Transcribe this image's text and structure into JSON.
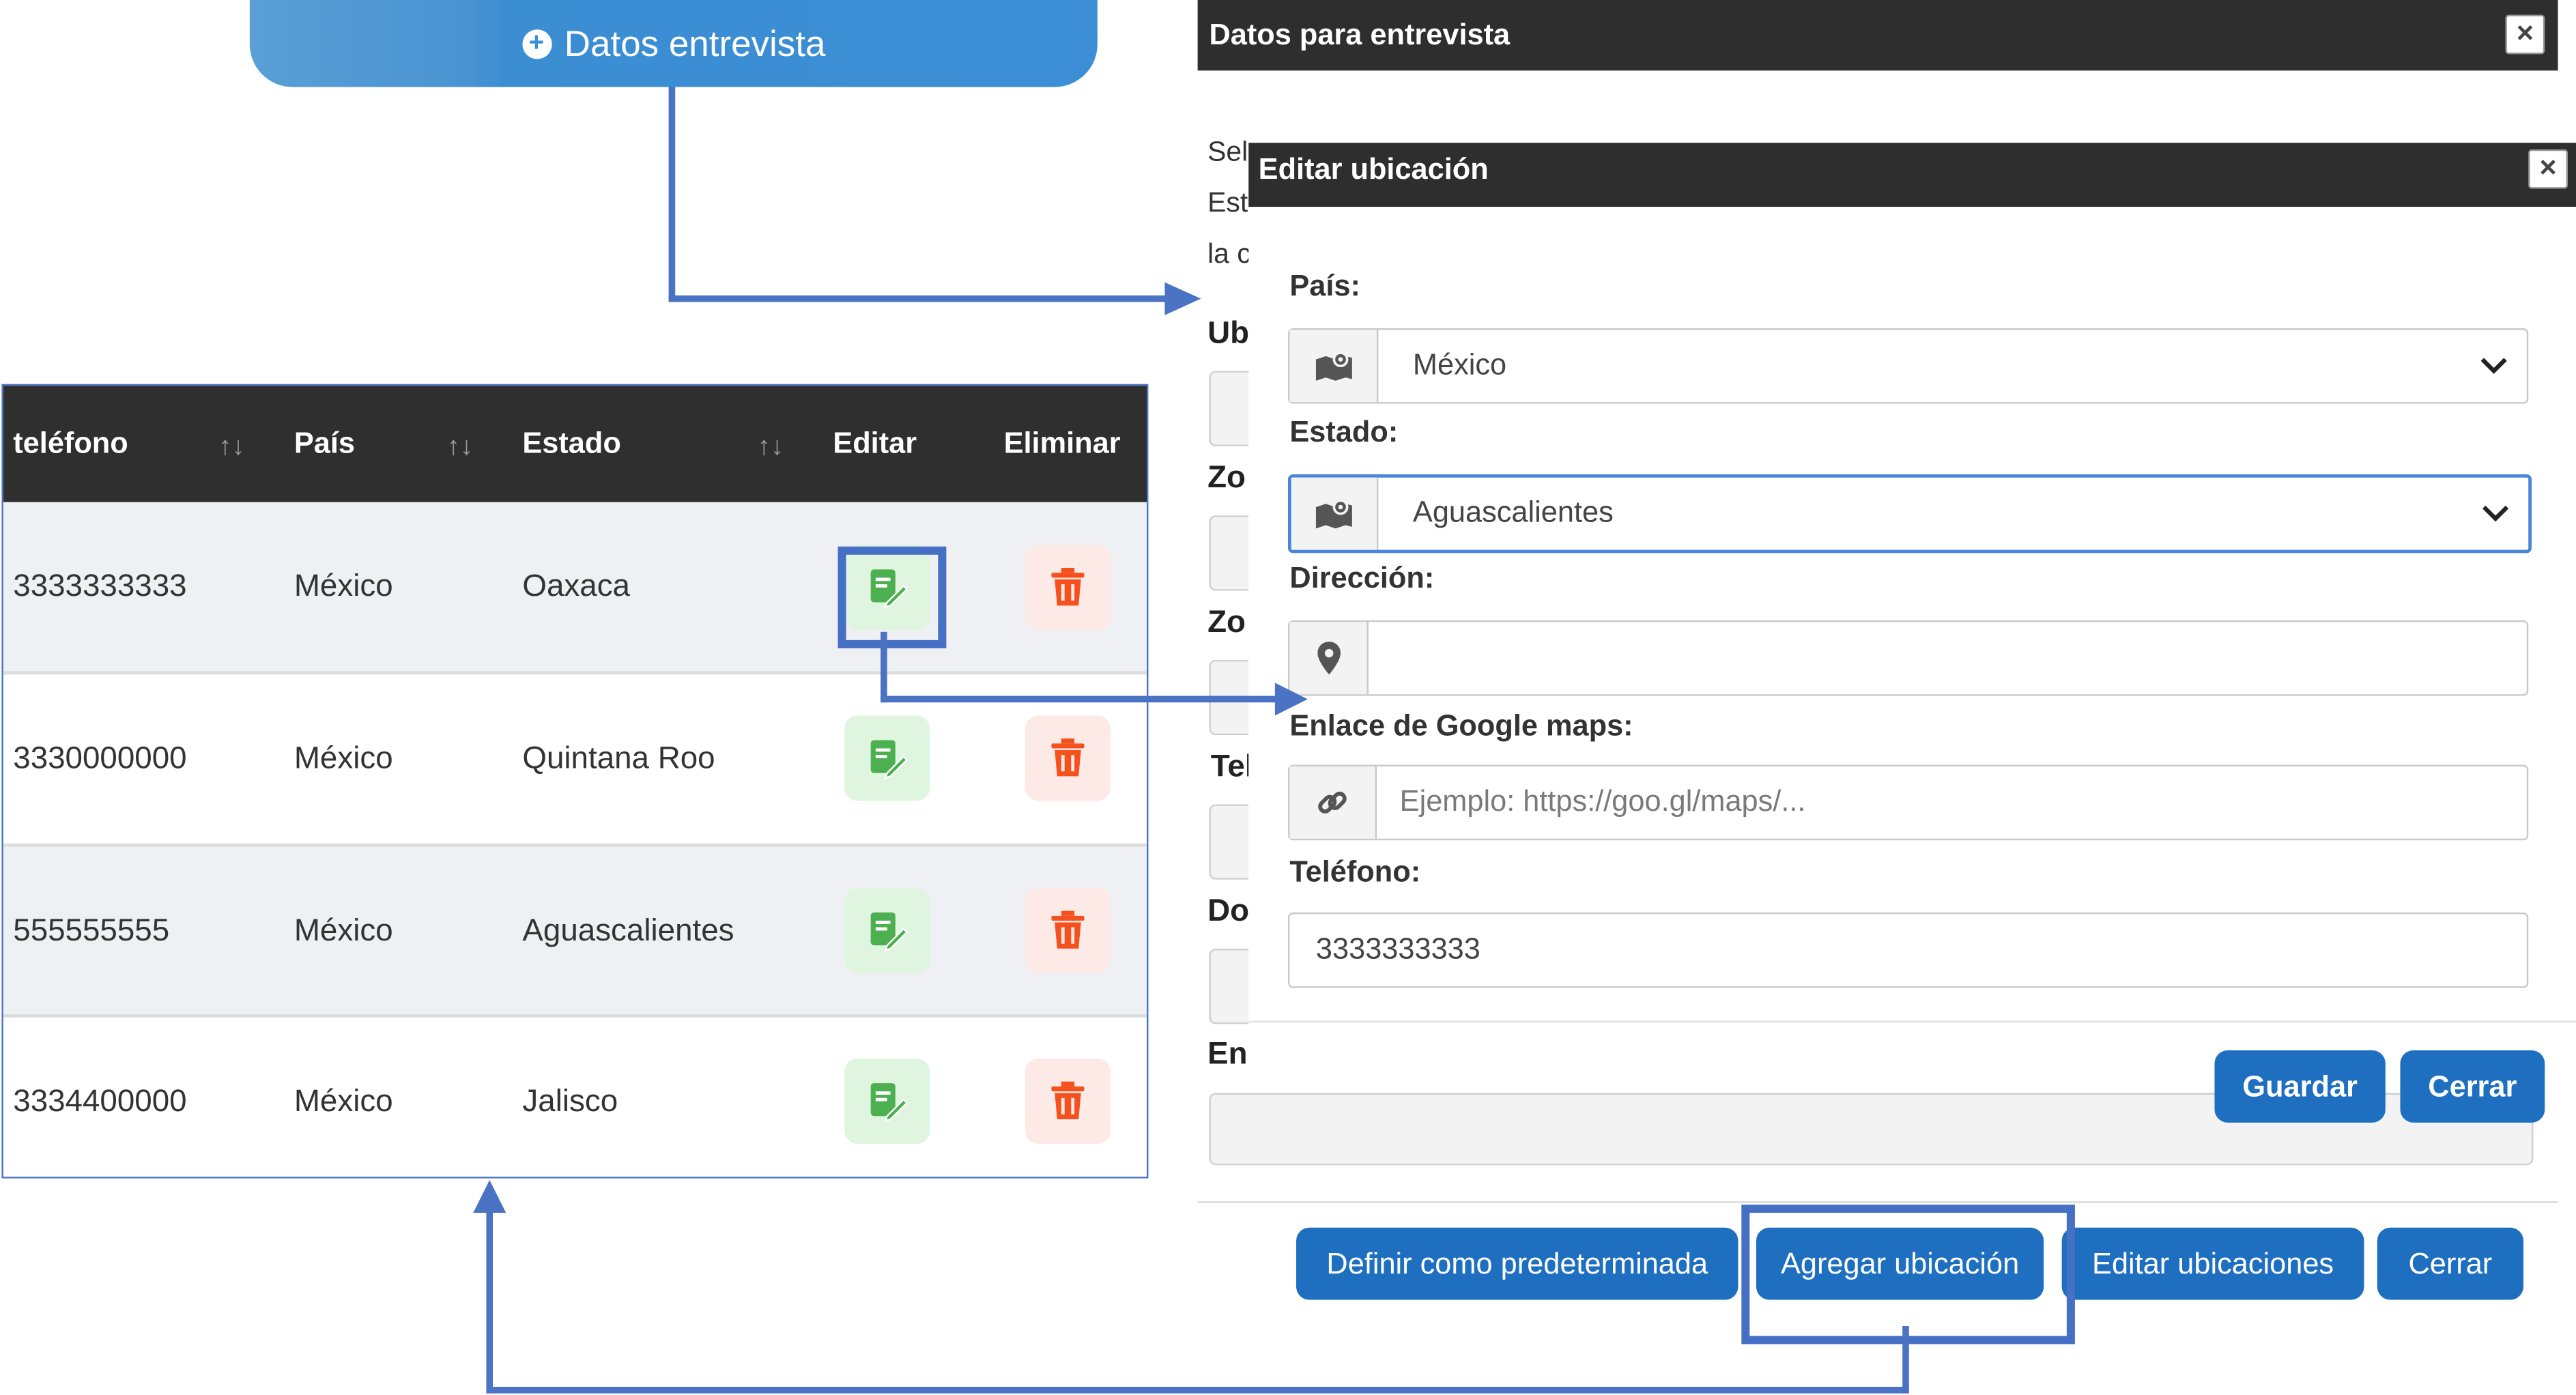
{
  "top_button": {
    "label": "Datos entrevista",
    "plus": "+"
  },
  "table": {
    "headers": {
      "telefono": "teléfono",
      "pais": "País",
      "estado": "Estado",
      "editar": "Editar",
      "eliminar": "Eliminar"
    },
    "sort_icon": "↑↓",
    "rows": [
      {
        "telefono": "3333333333",
        "pais": "México",
        "estado": "Oaxaca"
      },
      {
        "telefono": "3330000000",
        "pais": "México",
        "estado": "Quintana Roo"
      },
      {
        "telefono": "555555555",
        "pais": "México",
        "estado": "Aguascalientes"
      },
      {
        "telefono": "3334400000",
        "pais": "México",
        "estado": "Jalisco"
      }
    ],
    "row_icons": {
      "edit": "edit-document-icon",
      "delete": "trash-icon"
    }
  },
  "dialog_main": {
    "title": "Datos para entrevista",
    "close": "×",
    "fragments": [
      "Sel",
      "Est",
      "la c",
      "Ub",
      "Zo",
      "Zo",
      "Tel",
      "Do",
      "En"
    ],
    "footer": {
      "set_default": "Definir como predeterminada",
      "add_location": "Agregar ubicación",
      "edit_locations": "Editar ubicaciones",
      "close": "Cerrar"
    }
  },
  "dialog_edit": {
    "title": "Editar ubicación",
    "close": "×",
    "country": {
      "label": "País:",
      "value": "México",
      "icon": "map-icon"
    },
    "state": {
      "label": "Estado:",
      "value": "Aguascalientes",
      "icon": "map-icon"
    },
    "address": {
      "label": "Dirección:",
      "value": "",
      "icon": "map-marker-icon"
    },
    "maps_link": {
      "label": "Enlace de Google maps:",
      "placeholder": "Ejemplo: https://goo.gl/maps/...",
      "icon": "link-icon"
    },
    "phone": {
      "label": "Teléfono:",
      "value": "3333333333"
    },
    "save": "Guardar",
    "cancel": "Cerrar"
  },
  "colors": {
    "primary_button": "#1e6fc0",
    "header_dark": "#2e2e2e",
    "annotation": "#4570c4",
    "edit_green": "#4caf50",
    "delete_red": "#f4511e"
  }
}
